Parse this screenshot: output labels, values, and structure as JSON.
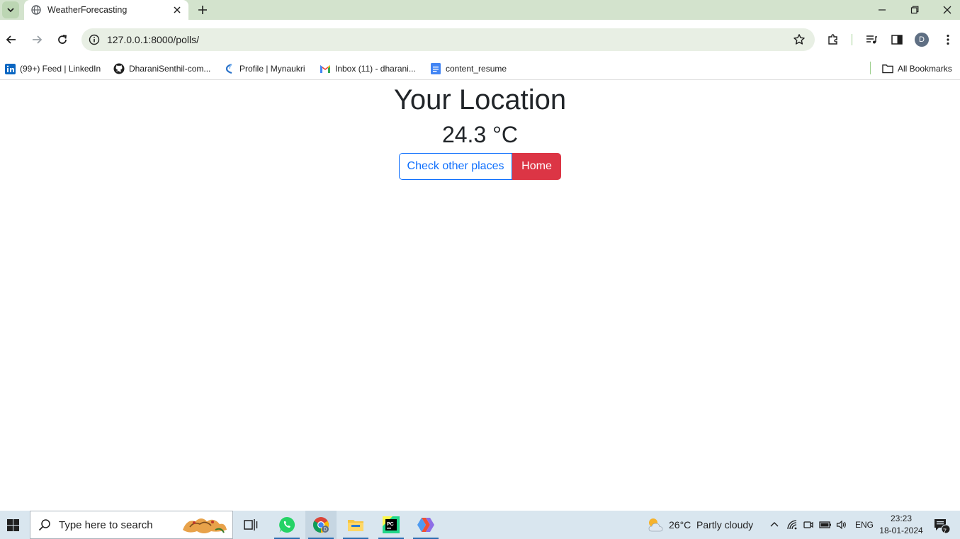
{
  "browser": {
    "tab": {
      "title": "WeatherForecasting"
    },
    "url": "127.0.0.1:8000/polls/",
    "profile_initial": "D",
    "bookmarks": [
      {
        "label": "(99+) Feed | LinkedIn",
        "icon": "linkedin-icon"
      },
      {
        "label": "DharaniSenthil-com...",
        "icon": "github-icon"
      },
      {
        "label": "Profile | Mynaukri",
        "icon": "naukri-icon"
      },
      {
        "label": "Inbox (11) - dharani...",
        "icon": "gmail-icon"
      },
      {
        "label": "content_resume",
        "icon": "docs-icon"
      }
    ],
    "all_bookmarks": "All Bookmarks"
  },
  "page": {
    "title": "Your Location",
    "temperature": "24.3 °C",
    "buttons": {
      "check_other": "Check other places",
      "home": "Home"
    }
  },
  "taskbar": {
    "search_placeholder": "Type here to search",
    "weather_temp": "26°C",
    "weather_desc": "Partly cloudy",
    "language": "ENG",
    "time": "23:23",
    "date": "18-01-2024",
    "notification_count": "7"
  },
  "colors": {
    "primary": "#0d6efd",
    "danger": "#dc3545",
    "titlebar": "#d3e3cd",
    "taskbar": "#d9e6ef"
  }
}
